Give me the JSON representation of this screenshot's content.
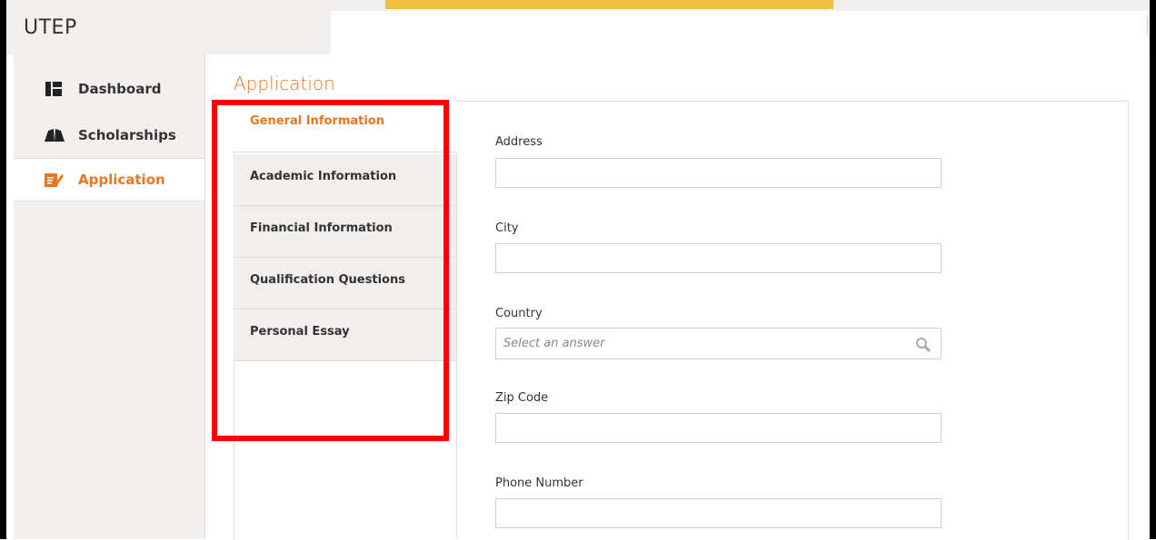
{
  "header": {
    "brand": "UTEP"
  },
  "sidebar": {
    "items": [
      {
        "label": "Dashboard",
        "icon": "dashboard-icon",
        "active": false
      },
      {
        "label": "Scholarships",
        "icon": "book-icon",
        "active": false
      },
      {
        "label": "Application",
        "icon": "edit-icon",
        "active": true
      }
    ]
  },
  "main": {
    "title": "Application",
    "tabs": [
      {
        "label": "General Information",
        "active": true
      },
      {
        "label": "Academic Information",
        "active": false
      },
      {
        "label": "Financial Information",
        "active": false
      },
      {
        "label": "Qualification Questions",
        "active": false
      },
      {
        "label": "Personal Essay",
        "active": false
      }
    ],
    "form": {
      "address": {
        "label": "Address",
        "value": ""
      },
      "city": {
        "label": "City",
        "value": ""
      },
      "country": {
        "label": "Country",
        "placeholder": "Select an answer"
      },
      "zip": {
        "label": "Zip Code",
        "value": ""
      },
      "phone": {
        "label": "Phone Number",
        "value": ""
      }
    }
  },
  "colors": {
    "accent": "#e87722",
    "annotation": "#ff0000",
    "top_bar": "#f0c040"
  }
}
